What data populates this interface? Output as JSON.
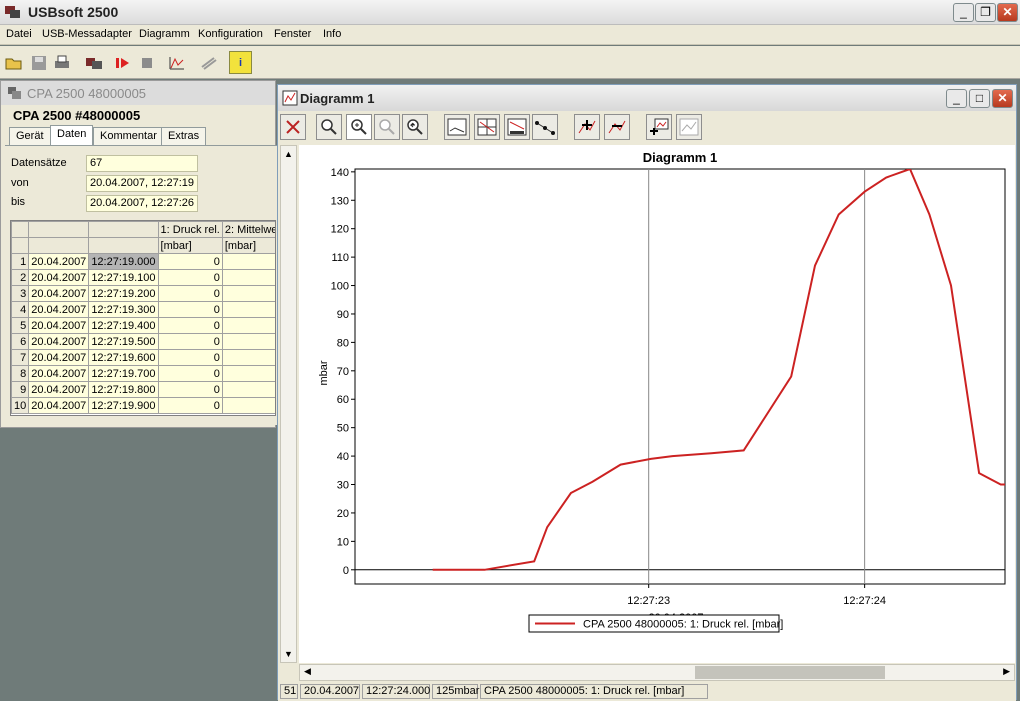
{
  "app": {
    "title": "USBsoft 2500"
  },
  "menu": [
    "Datei",
    "USB-Messadapter",
    "Diagramm",
    "Konfiguration",
    "Fenster",
    "Info"
  ],
  "toolbar_icons": [
    "open-icon",
    "save-icon",
    "print-icon",
    "device-icon",
    "record-icon",
    "stop-icon",
    "diagram-icon",
    "settings-icon",
    "info-icon"
  ],
  "device_window": {
    "title": "CPA 2500 48000005",
    "heading": "CPA 2500 #48000005",
    "tabs": [
      "Gerät",
      "Daten",
      "Kommentar",
      "Extras"
    ],
    "active_tab": "Daten",
    "fields": [
      {
        "label": "Datensätze",
        "value": "67"
      },
      {
        "label": "von",
        "value": "20.04.2007, 12:27:19"
      },
      {
        "label": "bis",
        "value": "20.04.2007, 12:27:26"
      }
    ],
    "table": {
      "headers": [
        "1: Druck rel.",
        "2: Mittelwe"
      ],
      "units": [
        "[mbar]",
        "[mbar]"
      ],
      "rows": [
        {
          "n": "1",
          "date": "20.04.2007",
          "time": "12:27:19.000",
          "v1": "0"
        },
        {
          "n": "2",
          "date": "20.04.2007",
          "time": "12:27:19.100",
          "v1": "0"
        },
        {
          "n": "3",
          "date": "20.04.2007",
          "time": "12:27:19.200",
          "v1": "0"
        },
        {
          "n": "4",
          "date": "20.04.2007",
          "time": "12:27:19.300",
          "v1": "0"
        },
        {
          "n": "5",
          "date": "20.04.2007",
          "time": "12:27:19.400",
          "v1": "0"
        },
        {
          "n": "6",
          "date": "20.04.2007",
          "time": "12:27:19.500",
          "v1": "0"
        },
        {
          "n": "7",
          "date": "20.04.2007",
          "time": "12:27:19.600",
          "v1": "0"
        },
        {
          "n": "8",
          "date": "20.04.2007",
          "time": "12:27:19.700",
          "v1": "0"
        },
        {
          "n": "9",
          "date": "20.04.2007",
          "time": "12:27:19.800",
          "v1": "0"
        },
        {
          "n": "10",
          "date": "20.04.2007",
          "time": "12:27:19.900",
          "v1": "0"
        }
      ]
    }
  },
  "diagram_window": {
    "title": "Diagramm 1",
    "toolbar_icons": [
      "tools-icon",
      "zoom-icon",
      "zoom-in-icon",
      "zoom-out-icon",
      "back-icon",
      "label-icon",
      "grid-icon",
      "scale-icon",
      "points-icon",
      "add-curve-icon",
      "remove-curve-icon",
      "export-icon",
      "table-icon"
    ],
    "status": [
      "51",
      "20.04.2007",
      "12:27:24.000",
      "125mbar",
      "CPA 2500 48000005: 1: Druck rel. [mbar]"
    ]
  },
  "chart_data": {
    "type": "line",
    "title": "Diagramm 1",
    "ylabel": "mbar",
    "xlabel": "20.04.2007",
    "ylim": [
      -5,
      141
    ],
    "yticks": [
      "140",
      "130",
      "120",
      "110",
      "100",
      "90",
      "80",
      "70",
      "60",
      "50",
      "40",
      "30",
      "20",
      "10",
      "0"
    ],
    "xticks": [
      "12:27:23",
      "12:27:24"
    ],
    "grid": true,
    "legend_position": "bottom-center",
    "series": [
      {
        "name": "CPA 2500 48000005: 1: Druck rel. [mbar]",
        "color": "#cc2222",
        "x": [
          22.0,
          22.15,
          22.24,
          22.47,
          22.53,
          22.64,
          22.74,
          22.87,
          23.01,
          23.11,
          23.29,
          23.44,
          23.66,
          23.77,
          23.88,
          24.0,
          24.1,
          24.21,
          24.3,
          24.4,
          24.53,
          24.63,
          24.65
        ],
        "values": [
          0,
          0,
          0,
          3,
          15,
          27,
          31,
          37,
          39,
          40,
          41,
          42,
          68,
          107,
          125,
          133,
          138,
          141,
          125,
          100,
          34,
          30,
          30
        ]
      }
    ]
  }
}
